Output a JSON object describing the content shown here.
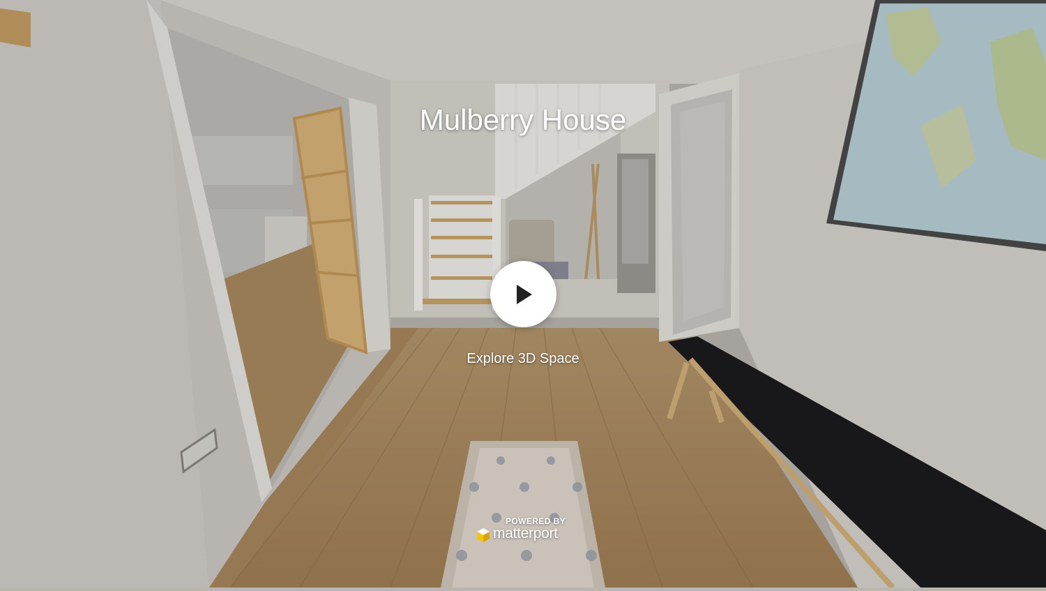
{
  "viewer": {
    "title": "Mulberry House",
    "play_icon": "play-icon",
    "cta": "Explore 3D Space"
  },
  "branding": {
    "powered_by": "POWERED BY",
    "name": "matterport",
    "logo_icon": "matterport-cube-icon",
    "logo_colors": [
      "#f6c500",
      "#d9a400",
      "#ffffff"
    ]
  }
}
